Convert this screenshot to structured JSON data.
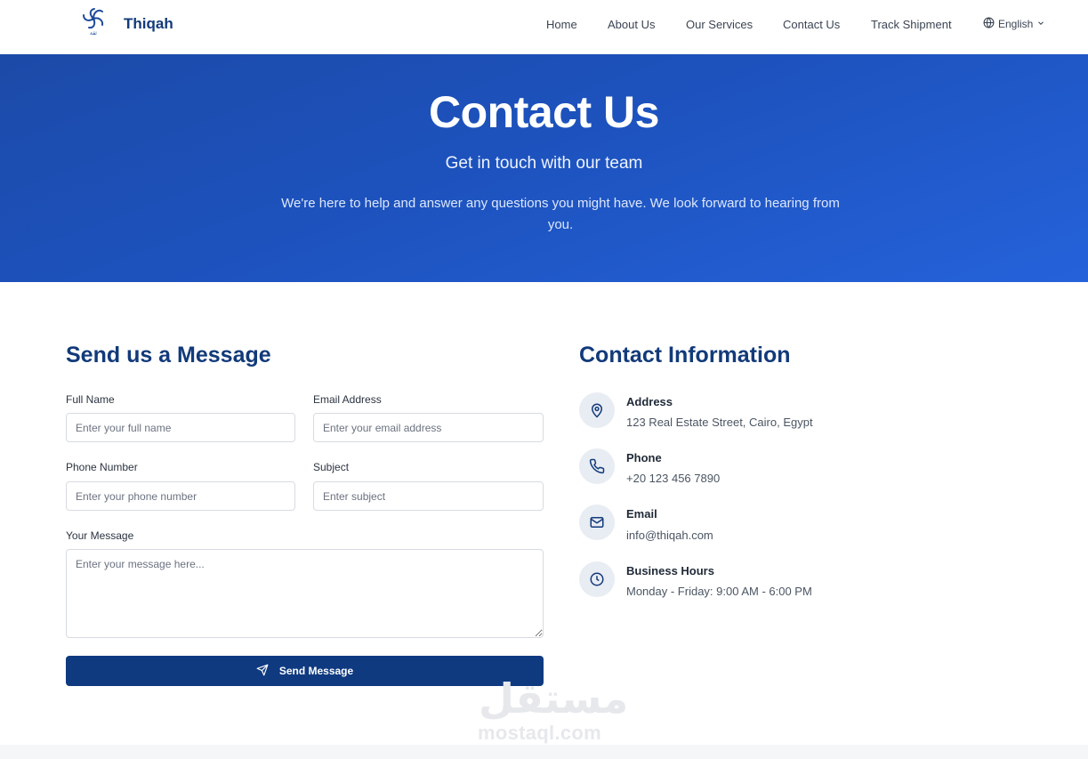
{
  "brand": {
    "name": "Thiqah",
    "logo_icon": "swirl-logo-icon",
    "logo_caption": "ثقة"
  },
  "nav": {
    "items": [
      "Home",
      "About Us",
      "Our Services",
      "Contact Us",
      "Track Shipment"
    ],
    "language": "English",
    "language_icon": "globe-icon"
  },
  "hero": {
    "title": "Contact Us",
    "subtitle": "Get in touch with our team",
    "description": "We're here to help and answer any questions you might have. We look forward to hearing from you."
  },
  "form": {
    "title": "Send us a Message",
    "full_name": {
      "label": "Full Name",
      "placeholder": "Enter your full name",
      "value": ""
    },
    "email": {
      "label": "Email Address",
      "placeholder": "Enter your email address",
      "value": ""
    },
    "phone": {
      "label": "Phone Number",
      "placeholder": "Enter your phone number",
      "value": ""
    },
    "subject": {
      "label": "Subject",
      "placeholder": "Enter subject",
      "value": ""
    },
    "message": {
      "label": "Your Message",
      "placeholder": "Enter your message here...",
      "value": ""
    },
    "submit_label": "Send Message",
    "submit_icon": "send-icon"
  },
  "contact_info": {
    "title": "Contact Information",
    "items": [
      {
        "icon": "map-pin-icon",
        "title": "Address",
        "value": "123 Real Estate Street, Cairo, Egypt"
      },
      {
        "icon": "phone-icon",
        "title": "Phone",
        "value": "+20 123 456 7890"
      },
      {
        "icon": "mail-icon",
        "title": "Email",
        "value": "info@thiqah.com"
      },
      {
        "icon": "clock-icon",
        "title": "Business Hours",
        "value": "Monday - Friday: 9:00 AM - 6:00 PM"
      }
    ]
  },
  "watermark": {
    "arabic": "مستقل",
    "latin": "mostaql.com"
  },
  "colors": {
    "primary": "#0f3a80",
    "hero_start": "#1c4aa8",
    "hero_end": "#2562da",
    "heading": "#123a7a"
  }
}
